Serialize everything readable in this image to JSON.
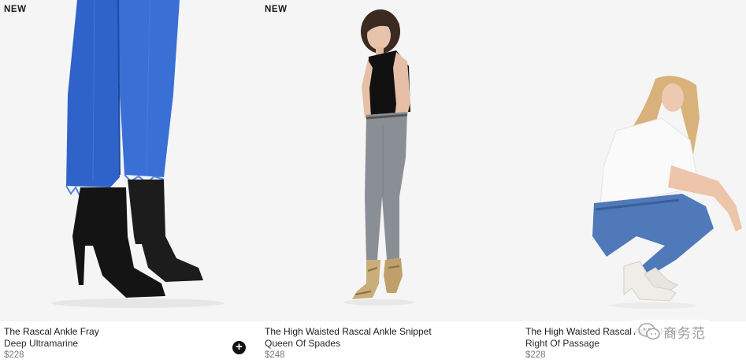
{
  "products": [
    {
      "badge": "NEW",
      "name": "The Rascal Ankle Fray",
      "color_name": "Deep Ultramarine",
      "price": "$228",
      "image_icon": "product-photo-jeans-boots"
    },
    {
      "badge": "NEW",
      "name": "The High Waisted Rascal Ankle Snippet",
      "color_name": "Queen Of Spades",
      "price": "$248",
      "image_icon": "product-photo-model-standing"
    },
    {
      "badge": "",
      "name": "The High Waisted Rascal Ankle Hem",
      "color_name": "Right Of Passage",
      "price": "$228",
      "image_icon": "product-photo-model-crouching"
    }
  ],
  "quick_add": {
    "symbol": "+",
    "icon": "plus-icon"
  },
  "watermark": {
    "text": "商务范",
    "icon": "wechat-icon"
  },
  "colors": {
    "background": "#f5f5f5",
    "text": "#1a1a1a",
    "price": "#7a7a7a",
    "button": "#111111"
  }
}
